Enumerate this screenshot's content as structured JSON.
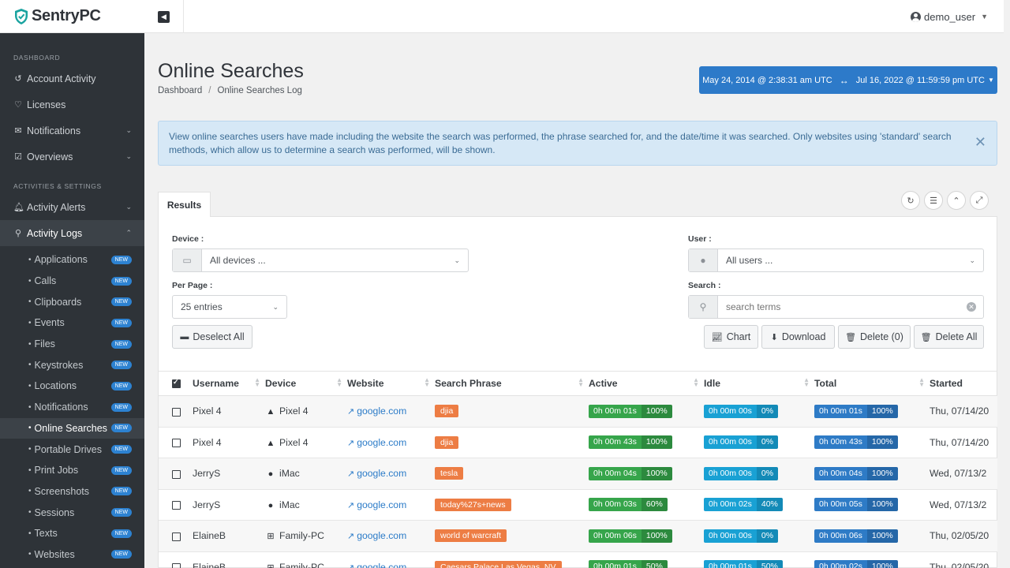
{
  "app": {
    "name": "SentryPC",
    "user": "demo_user"
  },
  "sidebar": {
    "sections": [
      {
        "header": "DASHBOARD"
      },
      {
        "header": "ACTIVITIES & SETTINGS"
      }
    ],
    "items": [
      {
        "label": "Account Activity"
      },
      {
        "label": "Licenses"
      },
      {
        "label": "Notifications"
      },
      {
        "label": "Overviews"
      },
      {
        "label": "Activity Alerts"
      },
      {
        "label": "Activity Logs"
      }
    ],
    "sub_items": [
      {
        "label": "Applications",
        "badge": "NEW"
      },
      {
        "label": "Calls",
        "badge": "NEW"
      },
      {
        "label": "Clipboards",
        "badge": "NEW"
      },
      {
        "label": "Events",
        "badge": "NEW"
      },
      {
        "label": "Files",
        "badge": "NEW"
      },
      {
        "label": "Keystrokes",
        "badge": "NEW"
      },
      {
        "label": "Locations",
        "badge": "NEW"
      },
      {
        "label": "Notifications",
        "badge": "NEW"
      },
      {
        "label": "Online Searches",
        "badge": "NEW"
      },
      {
        "label": "Portable Drives",
        "badge": "NEW"
      },
      {
        "label": "Print Jobs",
        "badge": "NEW"
      },
      {
        "label": "Screenshots",
        "badge": "NEW"
      },
      {
        "label": "Sessions",
        "badge": "NEW"
      },
      {
        "label": "Texts",
        "badge": "NEW"
      },
      {
        "label": "Websites",
        "badge": "NEW"
      }
    ]
  },
  "page": {
    "title": "Online Searches",
    "breadcrumb": [
      "Dashboard",
      "/",
      "Online Searches Log"
    ],
    "date_from": "May 24, 2014 @ 2:38:31 am UTC",
    "date_to": "Jul 16, 2022 @ 11:59:59 pm UTC",
    "alert": "View online searches users have made including the website the search was performed, the phrase searched for, and the date/time it was searched.  Only websites using 'standard' search methods, which allow us to determine a search was performed, will be shown."
  },
  "results": {
    "tab": "Results",
    "device_label": "Device :",
    "device_value": "All devices ...",
    "user_label": "User :",
    "user_value": "All users ...",
    "per_page_label": "Per Page :",
    "per_page_value": "25 entries",
    "search_label": "Search :",
    "search_placeholder": "search terms",
    "buttons": {
      "deselect_all": "Deselect All",
      "chart": "Chart",
      "download": "Download",
      "delete": "Delete (0)",
      "delete_all": "Delete All"
    },
    "columns": [
      "Username",
      "Device",
      "Website",
      "Search Phrase",
      "Active",
      "Idle",
      "Total",
      "Started"
    ],
    "rows": [
      {
        "user": "Pixel 4",
        "device": "Pixel 4",
        "device_icon": "android-icon",
        "site": "google.com",
        "phrase": "djia",
        "active": "0h 00m 01s",
        "active_pct": "100%",
        "idle": "0h 00m 00s",
        "idle_pct": "0%",
        "total": "0h 00m 01s",
        "total_pct": "100%",
        "started": "Thu, 07/14/20"
      },
      {
        "user": "Pixel 4",
        "device": "Pixel 4",
        "device_icon": "android-icon",
        "site": "google.com",
        "phrase": "djia",
        "active": "0h 00m 43s",
        "active_pct": "100%",
        "idle": "0h 00m 00s",
        "idle_pct": "0%",
        "total": "0h 00m 43s",
        "total_pct": "100%",
        "started": "Thu, 07/14/20"
      },
      {
        "user": "JerryS",
        "device": "iMac",
        "device_icon": "apple-icon",
        "site": "google.com",
        "phrase": "tesla",
        "active": "0h 00m 04s",
        "active_pct": "100%",
        "idle": "0h 00m 00s",
        "idle_pct": "0%",
        "total": "0h 00m 04s",
        "total_pct": "100%",
        "started": "Wed, 07/13/2"
      },
      {
        "user": "JerryS",
        "device": "iMac",
        "device_icon": "apple-icon",
        "site": "google.com",
        "phrase": "today%27s+news",
        "active": "0h 00m 03s",
        "active_pct": "60%",
        "idle": "0h 00m 02s",
        "idle_pct": "40%",
        "total": "0h 00m 05s",
        "total_pct": "100%",
        "started": "Wed, 07/13/2"
      },
      {
        "user": "ElaineB",
        "device": "Family-PC",
        "device_icon": "windows-icon",
        "site": "google.com",
        "phrase": "world of warcraft",
        "active": "0h 00m 06s",
        "active_pct": "100%",
        "idle": "0h 00m 00s",
        "idle_pct": "0%",
        "total": "0h 00m 06s",
        "total_pct": "100%",
        "started": "Thu, 02/05/20"
      },
      {
        "user": "ElaineB",
        "device": "Family-PC",
        "device_icon": "windows-icon",
        "site": "google.com",
        "phrase": "Caesars Palace Las Vegas, NV",
        "active": "0h 00m 01s",
        "active_pct": "50%",
        "idle": "0h 00m 01s",
        "idle_pct": "50%",
        "total": "0h 00m 02s",
        "total_pct": "100%",
        "started": "Thu, 02/05/20"
      }
    ]
  },
  "colors": {
    "sidebar_bg": "#2e3338",
    "accent": "#2d7ac9",
    "phrase_tag": "#ed7d44",
    "active": "#36a54b",
    "idle": "#19a1d4",
    "total": "#2e7bc6",
    "badge": "#2d82d1"
  }
}
